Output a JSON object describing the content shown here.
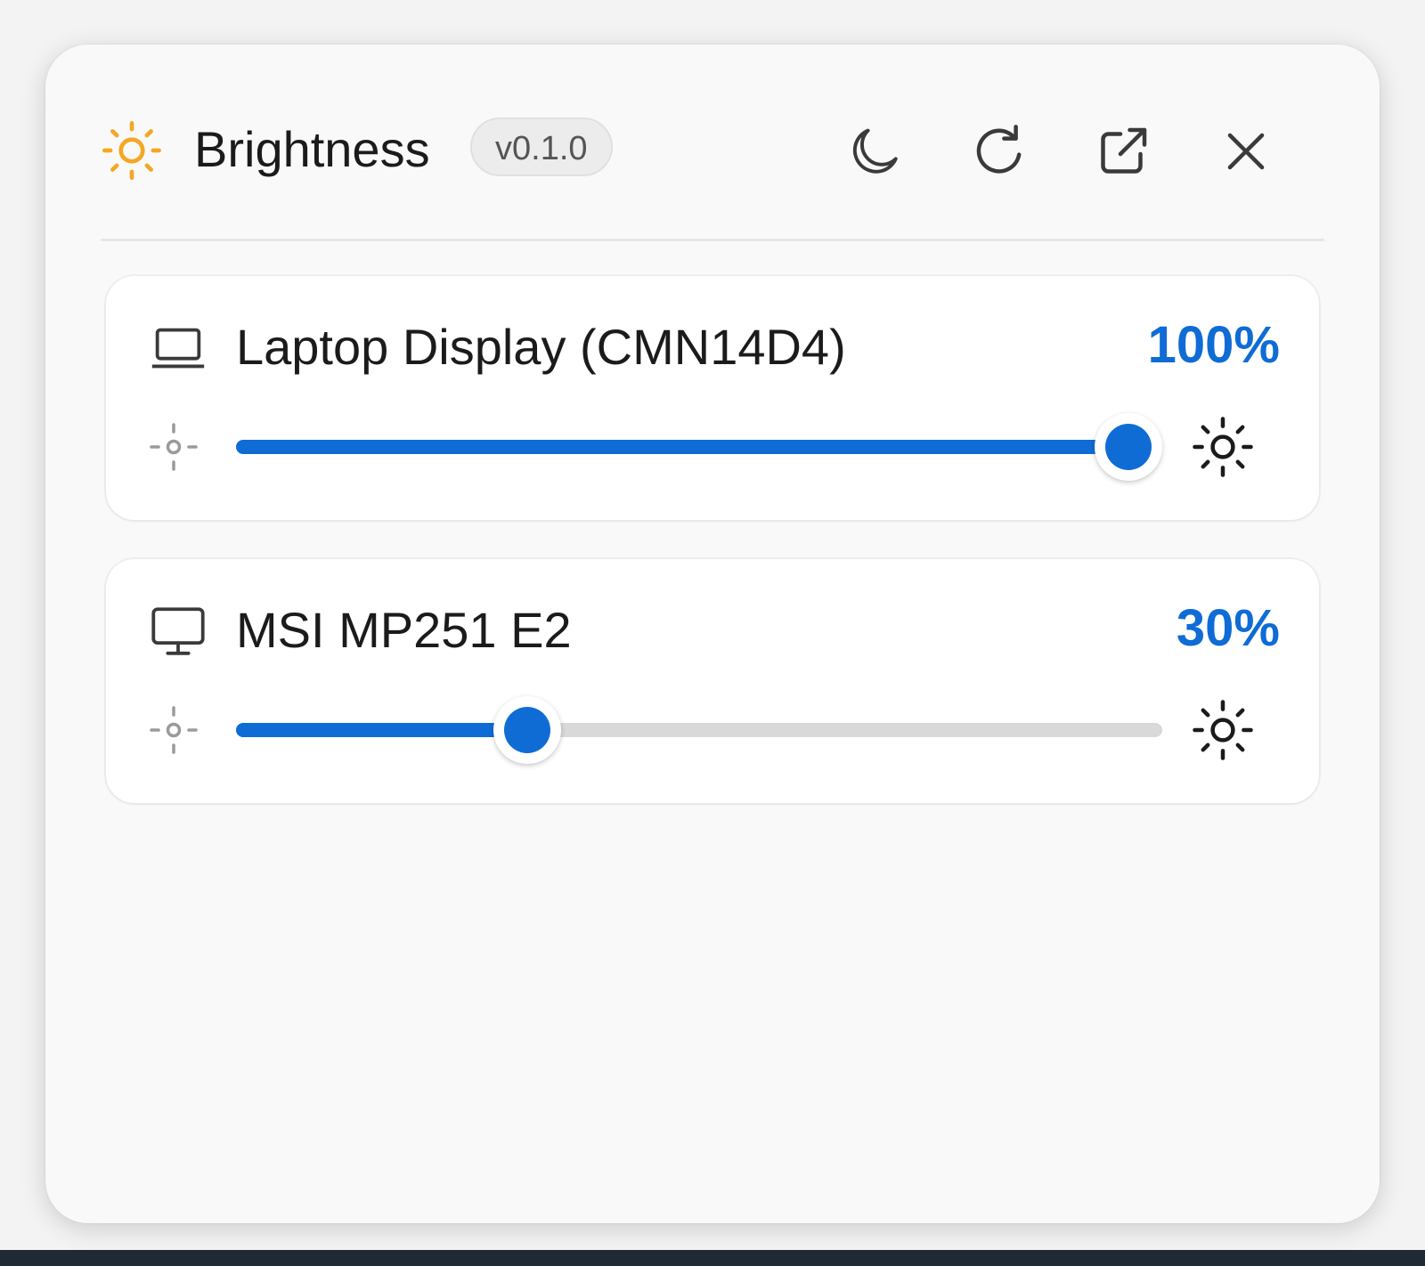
{
  "header": {
    "title": "Brightness",
    "version": "v0.1.0",
    "logo_icon": "sun-icon",
    "actions": [
      {
        "name": "night-mode-button",
        "icon": "moon-icon"
      },
      {
        "name": "refresh-button",
        "icon": "refresh-icon"
      },
      {
        "name": "pop-out-button",
        "icon": "external-link-icon"
      },
      {
        "name": "close-button",
        "icon": "close-icon"
      }
    ]
  },
  "displays": [
    {
      "name": "Laptop Display (CMN14D4)",
      "icon": "laptop-icon",
      "value_label": "100%",
      "brightness": 100
    },
    {
      "name": "MSI MP251 E2",
      "icon": "monitor-icon",
      "value_label": "30%",
      "brightness": 30
    }
  ],
  "colors": {
    "accent": "#0f6cd5",
    "logo": "#f5a623",
    "track": "#d9d9d9",
    "panel": "#f9f9f9",
    "card": "#ffffff"
  }
}
